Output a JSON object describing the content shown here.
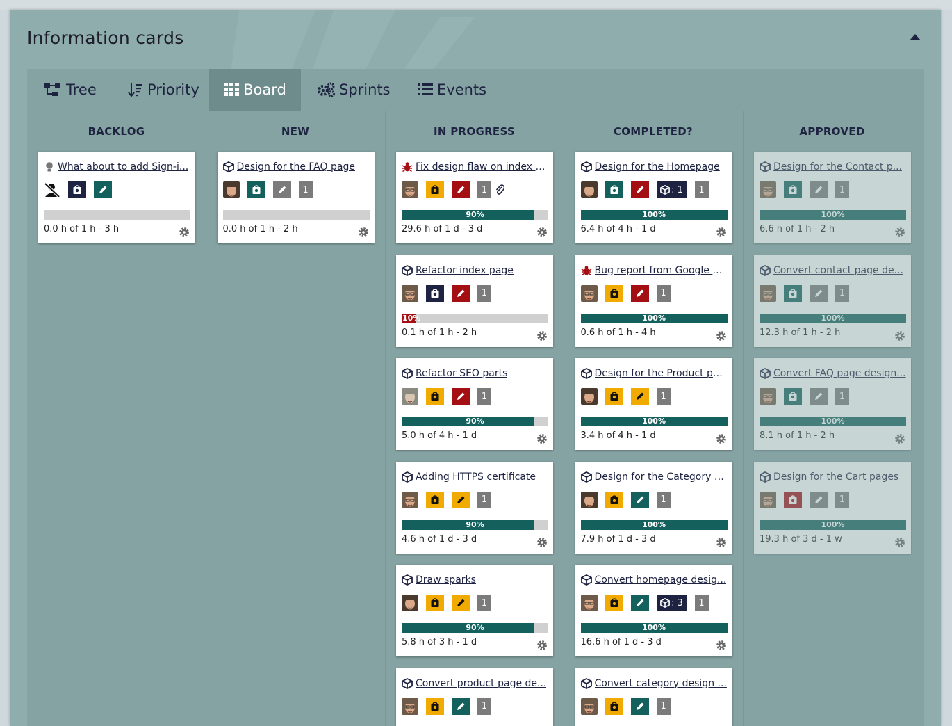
{
  "panel": {
    "title": "Information cards"
  },
  "tabs": [
    {
      "label": "Tree",
      "icon": "tree-icon",
      "active": false
    },
    {
      "label": "Priority",
      "icon": "sort-icon",
      "active": false
    },
    {
      "label": "Board",
      "icon": "grid-icon",
      "active": true
    },
    {
      "label": "Sprints",
      "icon": "gears-icon",
      "active": false
    },
    {
      "label": "Events",
      "icon": "list-icon",
      "active": false
    }
  ],
  "colors": {
    "dark": "#1d2340",
    "teal": "#13605c",
    "red": "#a40f14",
    "yellow": "#f0aa00",
    "gray": "#7b7b7b",
    "progress": "#13605c",
    "progress_low": "#a40f14"
  },
  "columns": [
    {
      "title": "BACKLOG",
      "cards": [
        {
          "title": "What about to add Sign-i...",
          "type": "idea-icon",
          "avatar": "unassigned",
          "badges": [
            {
              "kind": "status",
              "color": "dark"
            },
            {
              "kind": "pencil",
              "color": "teal"
            }
          ],
          "progress": null,
          "hours": "0.0 h of 1 h - 3 h",
          "faded": false
        }
      ]
    },
    {
      "title": "NEW",
      "cards": [
        {
          "title": "Design for the FAQ page",
          "type": "package-icon",
          "avatar": "a1",
          "badges": [
            {
              "kind": "status",
              "color": "teal"
            },
            {
              "kind": "pencil",
              "color": "gray"
            },
            {
              "kind": "count",
              "text": "1"
            }
          ],
          "progress": null,
          "hours": "0.0 h of 1 h - 2 h",
          "faded": false
        }
      ]
    },
    {
      "title": "IN PROGRESS",
      "cards": [
        {
          "title": "Fix design flaw on index p...",
          "type": "bug-icon",
          "avatar": "a2",
          "badges": [
            {
              "kind": "status",
              "color": "yellow"
            },
            {
              "kind": "pencil",
              "color": "red"
            },
            {
              "kind": "count",
              "text": "1"
            },
            {
              "kind": "clip"
            }
          ],
          "progress": 0.9,
          "progress_label": "90%",
          "hours": "29.6 h of 1 d - 3 d",
          "faded": false
        },
        {
          "title": "Refactor index page",
          "type": "package-icon",
          "avatar": "a2",
          "badges": [
            {
              "kind": "status",
              "color": "dark"
            },
            {
              "kind": "pencil",
              "color": "red"
            },
            {
              "kind": "count",
              "text": "1"
            }
          ],
          "progress": 0.1,
          "progress_label": "10%",
          "hours": "0.1 h of 1 h - 2 h",
          "faded": false
        },
        {
          "title": "Refactor SEO parts",
          "type": "package-icon",
          "avatar": "a3",
          "badges": [
            {
              "kind": "status",
              "color": "yellow"
            },
            {
              "kind": "pencil",
              "color": "red"
            },
            {
              "kind": "count",
              "text": "1"
            }
          ],
          "progress": 0.9,
          "progress_label": "90%",
          "hours": "5.0 h of 4 h - 1 d",
          "faded": false
        },
        {
          "title": "Adding HTTPS certificate",
          "type": "package-icon",
          "avatar": "a2",
          "badges": [
            {
              "kind": "status",
              "color": "yellow"
            },
            {
              "kind": "pencil",
              "color": "yellow"
            },
            {
              "kind": "count",
              "text": "1"
            }
          ],
          "progress": 0.9,
          "progress_label": "90%",
          "hours": "4.6 h of 1 d - 3 d",
          "faded": false
        },
        {
          "title": "Draw sparks",
          "type": "package-icon",
          "avatar": "a1",
          "badges": [
            {
              "kind": "status",
              "color": "yellow"
            },
            {
              "kind": "pencil",
              "color": "yellow"
            },
            {
              "kind": "count",
              "text": "1"
            }
          ],
          "progress": 0.9,
          "progress_label": "90%",
          "hours": "5.8 h of 3 h - 1 d",
          "faded": false
        },
        {
          "title": "Convert product page de...",
          "type": "package-icon",
          "avatar": "a2",
          "badges": [
            {
              "kind": "status",
              "color": "yellow"
            },
            {
              "kind": "pencil",
              "color": "teal"
            },
            {
              "kind": "count",
              "text": "1"
            }
          ],
          "progress": null,
          "hours": "",
          "faded": false
        }
      ]
    },
    {
      "title": "COMPLETED?",
      "cards": [
        {
          "title": "Design for the Homepage",
          "type": "package-icon",
          "avatar": "a1",
          "badges": [
            {
              "kind": "status",
              "color": "teal"
            },
            {
              "kind": "pencil",
              "color": "red"
            },
            {
              "kind": "sub",
              "text": ": 1"
            },
            {
              "kind": "count",
              "text": "1"
            }
          ],
          "progress": 1.0,
          "progress_label": "100%",
          "hours": "6.4 h of 4 h - 1 d",
          "faded": false
        },
        {
          "title": "Bug report from Google G...",
          "type": "bug-icon",
          "avatar": "a2",
          "badges": [
            {
              "kind": "status",
              "color": "yellow"
            },
            {
              "kind": "pencil",
              "color": "red"
            },
            {
              "kind": "count",
              "text": "1"
            }
          ],
          "progress": 1.0,
          "progress_label": "100%",
          "hours": "0.6 h of 1 h - 4 h",
          "faded": false
        },
        {
          "title": "Design for the Product pa...",
          "type": "package-icon",
          "avatar": "a1",
          "badges": [
            {
              "kind": "status",
              "color": "yellow"
            },
            {
              "kind": "pencil",
              "color": "yellow"
            },
            {
              "kind": "count",
              "text": "1"
            }
          ],
          "progress": 1.0,
          "progress_label": "100%",
          "hours": "3.4 h of 4 h - 1 d",
          "faded": false
        },
        {
          "title": "Design for the Category p...",
          "type": "package-icon",
          "avatar": "a1",
          "badges": [
            {
              "kind": "status",
              "color": "yellow"
            },
            {
              "kind": "pencil",
              "color": "teal"
            },
            {
              "kind": "count",
              "text": "1"
            }
          ],
          "progress": 1.0,
          "progress_label": "100%",
          "hours": "7.9 h of 1 d - 3 d",
          "faded": false
        },
        {
          "title": "Convert homepage desig...",
          "type": "package-icon",
          "avatar": "a2",
          "badges": [
            {
              "kind": "status",
              "color": "yellow"
            },
            {
              "kind": "pencil",
              "color": "teal"
            },
            {
              "kind": "sub",
              "text": ": 3"
            },
            {
              "kind": "count",
              "text": "1"
            }
          ],
          "progress": 1.0,
          "progress_label": "100%",
          "hours": "16.6 h of 1 d - 3 d",
          "faded": false
        },
        {
          "title": "Convert category design ...",
          "type": "package-icon",
          "avatar": "a2",
          "badges": [
            {
              "kind": "status",
              "color": "yellow"
            },
            {
              "kind": "pencil",
              "color": "teal"
            },
            {
              "kind": "count",
              "text": "1"
            }
          ],
          "progress": null,
          "hours": "",
          "faded": false
        }
      ]
    },
    {
      "title": "APPROVED",
      "cards": [
        {
          "title": "Design for the Contact p...",
          "type": "package-icon",
          "avatar": "a2",
          "badges": [
            {
              "kind": "status",
              "color": "teal"
            },
            {
              "kind": "pencil",
              "color": "gray"
            },
            {
              "kind": "count",
              "text": "1"
            }
          ],
          "progress": 1.0,
          "progress_label": "100%",
          "hours": "6.6 h of 1 h - 2 h",
          "faded": true
        },
        {
          "title": "Convert contact page de...",
          "type": "package-icon",
          "avatar": "a2",
          "badges": [
            {
              "kind": "status",
              "color": "teal"
            },
            {
              "kind": "pencil",
              "color": "gray"
            },
            {
              "kind": "count",
              "text": "1"
            }
          ],
          "progress": 1.0,
          "progress_label": "100%",
          "hours": "12.3 h of 1 h - 2 h",
          "faded": true
        },
        {
          "title": "Convert FAQ page design...",
          "type": "package-icon",
          "avatar": "a2",
          "badges": [
            {
              "kind": "status",
              "color": "teal"
            },
            {
              "kind": "pencil",
              "color": "gray"
            },
            {
              "kind": "count",
              "text": "1"
            }
          ],
          "progress": 1.0,
          "progress_label": "100%",
          "hours": "8.1 h of 1 h - 2 h",
          "faded": true
        },
        {
          "title": "Design for the Cart pages",
          "type": "package-icon",
          "avatar": "a2",
          "badges": [
            {
              "kind": "status",
              "color": "red"
            },
            {
              "kind": "pencil",
              "color": "gray"
            },
            {
              "kind": "count",
              "text": "1"
            }
          ],
          "progress": 1.0,
          "progress_label": "100%",
          "hours": "19.3 h of 3 d - 1 w",
          "faded": true
        }
      ]
    }
  ]
}
